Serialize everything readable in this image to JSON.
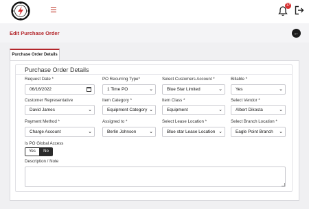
{
  "header": {
    "notification_count": "17"
  },
  "page": {
    "title": "Edit Purchase Order"
  },
  "tabs": [
    {
      "label": "Purchase Order Details"
    }
  ],
  "form": {
    "section_title": "Purchase Order Details",
    "request_date": {
      "label": "Request Date *",
      "value": "06/16/2022"
    },
    "po_recurring_type": {
      "label": "PO Recurring Type*",
      "value": "1 Time PO"
    },
    "customers_account": {
      "label": "Select Customers Account *",
      "value": "Blue Star Limited"
    },
    "billable": {
      "label": "Billable *",
      "value": "Yes"
    },
    "customer_representative": {
      "label": "Customer Representative",
      "value": "David James"
    },
    "item_category": {
      "label": "Item Category *",
      "value": "Equipment Category"
    },
    "item_class": {
      "label": "Item Class *",
      "value": "Equipment"
    },
    "vendor": {
      "label": "Select Vendor *",
      "value": "Albert Dikosta"
    },
    "payment_method": {
      "label": "Payment Method *",
      "value": "Charge Account"
    },
    "assigned_to": {
      "label": "Assigned to *",
      "value": "Berlin Johnson"
    },
    "lease_location": {
      "label": "Select Lease Location *",
      "value": "Blue star Lease Location"
    },
    "branch_location": {
      "label": "Select Branch Location *",
      "value": "Eagle Point Branch"
    },
    "po_global_access": {
      "label": "Is PO Global Access",
      "yes_label": "Yes",
      "no_label": "No",
      "selected": "No"
    },
    "description": {
      "label": "Description / Note",
      "value": ""
    }
  },
  "colors": {
    "brand": "#b3262b",
    "badge": "#d63031",
    "toggle_active": "#2b2b2b"
  },
  "icons": [
    "logo-icon",
    "hamburger-icon",
    "bell-icon",
    "logout-icon",
    "back-arrow-icon",
    "calendar-icon",
    "chevron-down-icon"
  ]
}
